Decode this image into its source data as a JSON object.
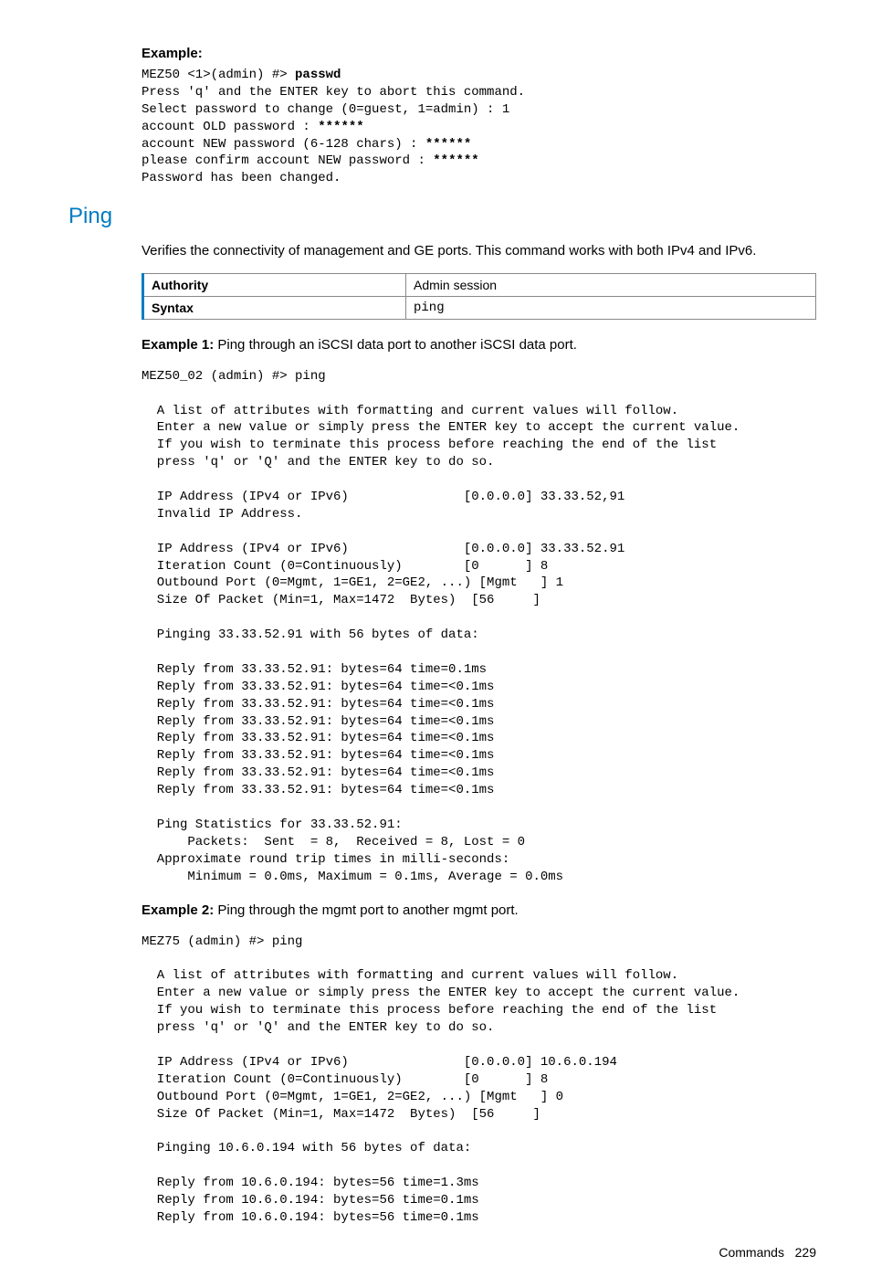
{
  "example0": {
    "heading": "Example:",
    "prompt_prefix": "MEZ50 <1>(admin) #> ",
    "prompt_cmd": "passwd",
    "body": "Press 'q' and the ENTER key to abort this command.\nSelect password to change (0=guest, 1=admin) : 1\naccount OLD password : ",
    "stars1": "******",
    "line_new": "\naccount NEW password (6-128 chars) : ",
    "stars2": "******",
    "line_confirm": "\nplease confirm account NEW password : ",
    "stars3": "******",
    "line_done": "\nPassword has been changed."
  },
  "ping": {
    "title": "Ping",
    "description": "Verifies the connectivity of management and GE ports. This command works with both IPv4 and IPv6.",
    "table": {
      "authority_label": "Authority",
      "authority_value": "Admin session",
      "syntax_label": "Syntax",
      "syntax_value": "ping"
    },
    "example1": {
      "lead": "Example 1: ",
      "desc": "Ping through an iSCSI data port to another iSCSI data port.",
      "code": "MEZ50_02 (admin) #> ping\n\n  A list of attributes with formatting and current values will follow.\n  Enter a new value or simply press the ENTER key to accept the current value.\n  If you wish to terminate this process before reaching the end of the list\n  press 'q' or 'Q' and the ENTER key to do so.\n\n  IP Address (IPv4 or IPv6)               [0.0.0.0] 33.33.52,91\n  Invalid IP Address.\n\n  IP Address (IPv4 or IPv6)               [0.0.0.0] 33.33.52.91\n  Iteration Count (0=Continuously)        [0      ] 8\n  Outbound Port (0=Mgmt, 1=GE1, 2=GE2, ...) [Mgmt   ] 1\n  Size Of Packet (Min=1, Max=1472  Bytes)  [56     ]\n\n  Pinging 33.33.52.91 with 56 bytes of data:\n\n  Reply from 33.33.52.91: bytes=64 time=0.1ms\n  Reply from 33.33.52.91: bytes=64 time=<0.1ms\n  Reply from 33.33.52.91: bytes=64 time=<0.1ms\n  Reply from 33.33.52.91: bytes=64 time=<0.1ms\n  Reply from 33.33.52.91: bytes=64 time=<0.1ms\n  Reply from 33.33.52.91: bytes=64 time=<0.1ms\n  Reply from 33.33.52.91: bytes=64 time=<0.1ms\n  Reply from 33.33.52.91: bytes=64 time=<0.1ms\n\n  Ping Statistics for 33.33.52.91:\n      Packets:  Sent  = 8,  Received = 8, Lost = 0\n  Approximate round trip times in milli-seconds:\n      Minimum = 0.0ms, Maximum = 0.1ms, Average = 0.0ms"
    },
    "example2": {
      "lead": "Example 2: ",
      "desc": "Ping through the mgmt port to another mgmt port.",
      "code": "MEZ75 (admin) #> ping\n\n  A list of attributes with formatting and current values will follow.\n  Enter a new value or simply press the ENTER key to accept the current value.\n  If you wish to terminate this process before reaching the end of the list\n  press 'q' or 'Q' and the ENTER key to do so.\n\n  IP Address (IPv4 or IPv6)               [0.0.0.0] 10.6.0.194\n  Iteration Count (0=Continuously)        [0      ] 8\n  Outbound Port (0=Mgmt, 1=GE1, 2=GE2, ...) [Mgmt   ] 0\n  Size Of Packet (Min=1, Max=1472  Bytes)  [56     ]\n\n  Pinging 10.6.0.194 with 56 bytes of data:\n\n  Reply from 10.6.0.194: bytes=56 time=1.3ms\n  Reply from 10.6.0.194: bytes=56 time=0.1ms\n  Reply from 10.6.0.194: bytes=56 time=0.1ms"
    }
  },
  "footer": {
    "section": "Commands",
    "page": "229"
  }
}
